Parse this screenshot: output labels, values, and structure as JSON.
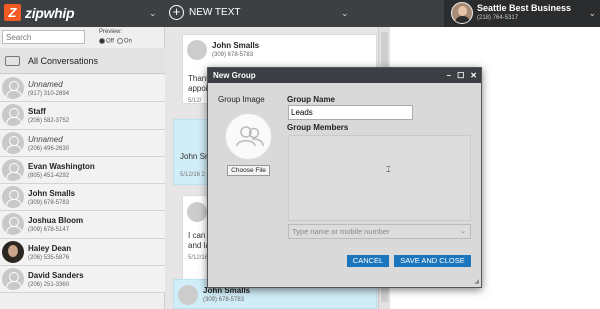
{
  "header": {
    "logo_mark": "Z",
    "logo_text": "zipwhip",
    "new_text_label": "NEW TEXT",
    "account_name": "Seattle Best Business",
    "account_phone": "(218) 764-5317"
  },
  "sidebar": {
    "search_placeholder": "Search",
    "preview_label": "Preview:",
    "preview_off": "Off",
    "preview_on": "On",
    "all_conversations": "All Conversations",
    "conversations": [
      {
        "name": "Unnamed",
        "phone": "(917) 310-2894",
        "italic": true
      },
      {
        "name": "Staff",
        "phone": "(206) 582-3752",
        "italic": false
      },
      {
        "name": "Unnamed",
        "phone": "(206) 496-2630",
        "italic": true
      },
      {
        "name": "Evan Washington",
        "phone": "(805) 451-4292",
        "italic": false
      },
      {
        "name": "John Smalls",
        "phone": "(309) 678-5783",
        "italic": false
      },
      {
        "name": "Joshua Bloom",
        "phone": "(309) 678-5147",
        "italic": false
      },
      {
        "name": "Haley Dean",
        "phone": "(206) 535-5876",
        "italic": false
      },
      {
        "name": "David Sanders",
        "phone": "(206) 251-3360",
        "italic": false
      }
    ]
  },
  "thread": {
    "messages": [
      {
        "name": "John Smalls",
        "phone": "(309) 678-5783",
        "text1": "Thank",
        "text2": "appoi",
        "time": "5/12/"
      },
      {
        "name": "John Sm",
        "phone": "",
        "text1": "",
        "text2": "",
        "time": "5/12/16 2"
      },
      {
        "name": "",
        "phone": "",
        "text1": "I can",
        "text2": "and la",
        "time": "5/12/16"
      },
      {
        "name": "John Smalls",
        "phone": "(309) 678-5783",
        "text1": "",
        "text2": "",
        "time": ""
      }
    ]
  },
  "modal": {
    "title": "New Group",
    "minimize": "–",
    "maximize": "☐",
    "close": "✕",
    "group_image_label": "Group Image",
    "choose_file": "Choose File",
    "group_name_label": "Group Name",
    "group_name_value": "Leads",
    "group_members_label": "Group Members",
    "member_placeholder": "Type name or mobile number",
    "cancel": "CANCEL",
    "save_and_close": "SAVE AND CLOSE"
  },
  "colors": {
    "topbar": "#3d4043",
    "brand": "#f15a24",
    "button": "#1b75bc",
    "bubble_blue": "#d1edf7"
  }
}
